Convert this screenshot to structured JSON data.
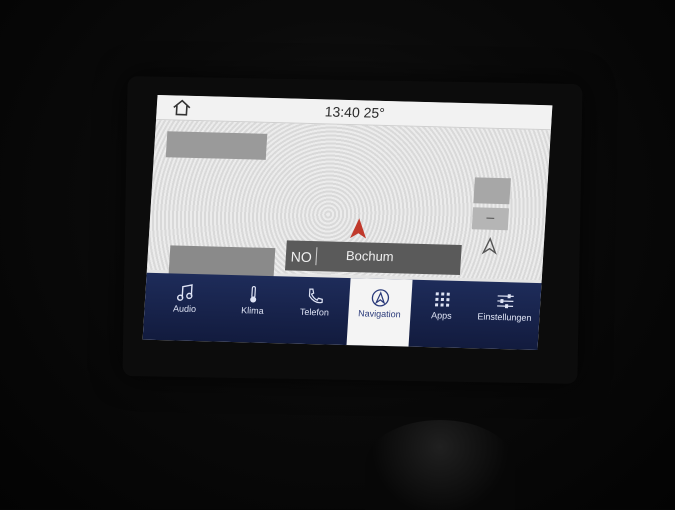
{
  "status": {
    "time_temp": "13:40  25°"
  },
  "map": {
    "heading": "NO",
    "street": "Bochum",
    "zoom_out": "–"
  },
  "navbar": {
    "items": [
      {
        "label": "Audio",
        "icon": "music-note-icon"
      },
      {
        "label": "Klima",
        "icon": "thermometer-icon"
      },
      {
        "label": "Telefon",
        "icon": "phone-icon"
      },
      {
        "label": "Navigation",
        "icon": "navigation-icon",
        "active": true
      },
      {
        "label": "Apps",
        "icon": "apps-grid-icon"
      },
      {
        "label": "Einstellungen",
        "icon": "sliders-icon"
      }
    ]
  }
}
